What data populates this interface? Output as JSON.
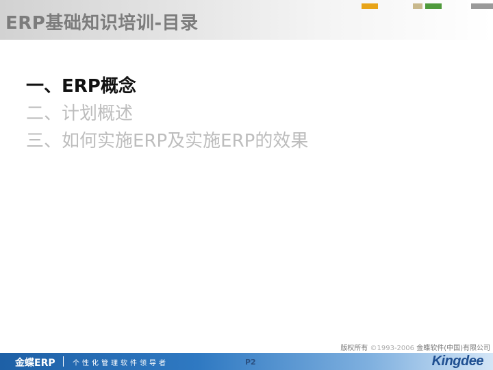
{
  "header": {
    "title": "ERP基础知识培训-目录"
  },
  "agenda": {
    "items": [
      {
        "label": "一、ERP概念",
        "active": true
      },
      {
        "label": "二、计划概述",
        "active": false
      },
      {
        "label": "三、如何实施ERP及实施ERP的效果",
        "active": false
      }
    ]
  },
  "copyright": {
    "prefix": "版权所有 ",
    "years": "©1993-2006",
    "owner": " 金蝶软件(中国)有限公司"
  },
  "footer": {
    "brand": "金蝶ERP",
    "slogan": "个性化管理软件领导者",
    "page": "P2",
    "logo": "Kingdee"
  },
  "colors": {
    "active_text": "#111111",
    "inactive_text": "#bdbdbd",
    "footer_blue": "#1e60a6",
    "logo_blue": "#1f4f91"
  }
}
